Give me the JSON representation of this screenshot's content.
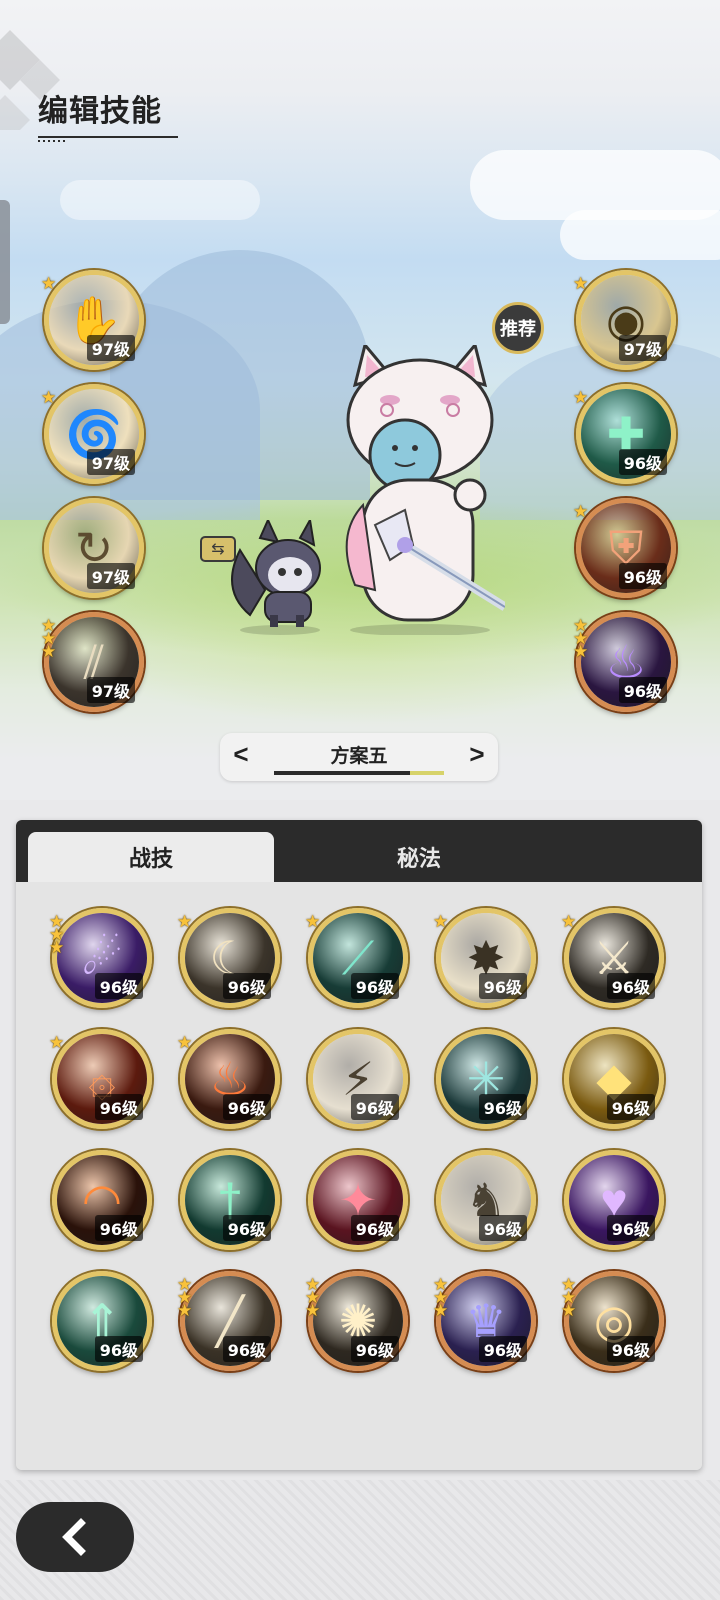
{
  "header": {
    "title": "编辑技能"
  },
  "recommend_label": "推荐",
  "plan": {
    "prev_label": "<",
    "name": "方案五",
    "next_label": ">"
  },
  "tabs": [
    {
      "label": "战技",
      "active": true
    },
    {
      "label": "秘法",
      "active": false
    }
  ],
  "equipped_left": [
    {
      "icon": "grasping-hand-icon",
      "level": "97级",
      "stars": 1,
      "theme": "gold"
    },
    {
      "icon": "wind-swirl-icon",
      "level": "97级",
      "stars": 1,
      "theme": "gold"
    },
    {
      "icon": "cyclone-icon",
      "level": "97级",
      "stars": 0,
      "theme": "gold"
    },
    {
      "icon": "claw-slash-icon",
      "level": "97级",
      "stars": 3,
      "theme": "bronze"
    }
  ],
  "equipped_right": [
    {
      "icon": "eye-triangle-icon",
      "level": "97级",
      "stars": 1,
      "theme": "gold"
    },
    {
      "icon": "healing-plus-icon",
      "level": "96级",
      "stars": 1,
      "theme": "gold"
    },
    {
      "icon": "armor-icon",
      "level": "96级",
      "stars": 1,
      "theme": "bronze"
    },
    {
      "icon": "purple-flame-icon",
      "level": "96级",
      "stars": 3,
      "theme": "bronze"
    }
  ],
  "skills_grid": [
    {
      "icon": "purple-comet-icon",
      "level": "96级",
      "stars": 3,
      "theme": "gold"
    },
    {
      "icon": "crescent-moon-icon",
      "level": "96级",
      "stars": 1,
      "theme": "gold"
    },
    {
      "icon": "green-slash-icon",
      "level": "96级",
      "stars": 1,
      "theme": "gold"
    },
    {
      "icon": "spike-burst-icon",
      "level": "96级",
      "stars": 1,
      "theme": "gold"
    },
    {
      "icon": "swordsman-icon",
      "level": "96级",
      "stars": 1,
      "theme": "gold"
    },
    {
      "icon": "fire-sigil-icon",
      "level": "96级",
      "stars": 1,
      "theme": "gold"
    },
    {
      "icon": "blaze-icon",
      "level": "96级",
      "stars": 1,
      "theme": "gold"
    },
    {
      "icon": "lightning-blade-icon",
      "level": "96级",
      "stars": 0,
      "theme": "gold"
    },
    {
      "icon": "spider-web-icon",
      "level": "96级",
      "stars": 0,
      "theme": "gold"
    },
    {
      "icon": "gold-crystal-icon",
      "level": "96级",
      "stars": 0,
      "theme": "gold"
    },
    {
      "icon": "fire-arc-icon",
      "level": "96级",
      "stars": 0,
      "theme": "gold"
    },
    {
      "icon": "green-sword-icon",
      "level": "96级",
      "stars": 0,
      "theme": "gold"
    },
    {
      "icon": "crimson-strike-icon",
      "level": "96级",
      "stars": 0,
      "theme": "gold"
    },
    {
      "icon": "beast-charge-icon",
      "level": "96级",
      "stars": 0,
      "theme": "gold"
    },
    {
      "icon": "violet-heart-icon",
      "level": "96级",
      "stars": 0,
      "theme": "gold"
    },
    {
      "icon": "green-ascend-icon",
      "level": "96级",
      "stars": 0,
      "theme": "gold"
    },
    {
      "icon": "sword-sweep-icon",
      "level": "96级",
      "stars": 3,
      "theme": "bronze"
    },
    {
      "icon": "star-burst-icon",
      "level": "96级",
      "stars": 3,
      "theme": "bronze"
    },
    {
      "icon": "shadow-beast-icon",
      "level": "96级",
      "stars": 3,
      "theme": "bronze"
    },
    {
      "icon": "golden-vortex-icon",
      "level": "96级",
      "stars": 3,
      "theme": "bronze"
    }
  ],
  "back_button": {
    "icon": "back-arrow-icon"
  }
}
